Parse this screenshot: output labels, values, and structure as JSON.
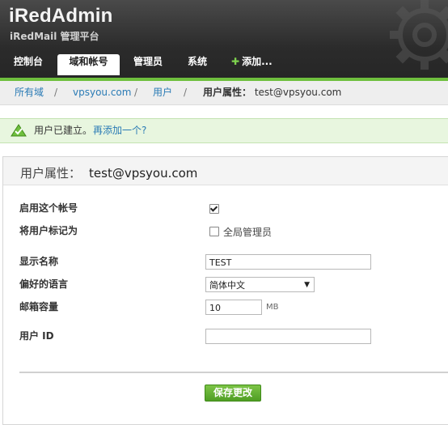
{
  "app": {
    "name": "iRedAdmin",
    "subtitle": "iRedMail 管理平台"
  },
  "nav": {
    "tabs": [
      {
        "label": "控制台"
      },
      {
        "label": "域和帐号",
        "active": true
      },
      {
        "label": "管理员"
      },
      {
        "label": "系统"
      },
      {
        "label": "添加..."
      }
    ]
  },
  "breadcrumb": {
    "all_domains": "所有域",
    "domain": "vpsyou.com",
    "users": "用户",
    "current_label": "用户属性：",
    "current_value": "test@vpsyou.com",
    "separator": "/"
  },
  "alert": {
    "message": "用户已建立。",
    "link": "再添加一个?"
  },
  "panel": {
    "title": "用户属性：",
    "email": "test@vpsyou.com"
  },
  "form": {
    "enable_label": "启用这个帐号",
    "enable_checked": true,
    "mark_label": "将用户标记为",
    "global_admin_label": "全局管理员",
    "global_admin_checked": false,
    "display_name_label": "显示名称",
    "display_name_value": "TEST",
    "language_label": "偏好的语言",
    "language_value": "简体中文",
    "quota_label": "邮箱容量",
    "quota_value": "10",
    "quota_unit": "MB",
    "userid_label": "用户 ID",
    "userid_value": "",
    "save_label": "保存更改"
  },
  "colors": {
    "accent_green": "#6fbf3e",
    "link_blue": "#2a7bb5",
    "header_dark": "#2b2b2b"
  }
}
